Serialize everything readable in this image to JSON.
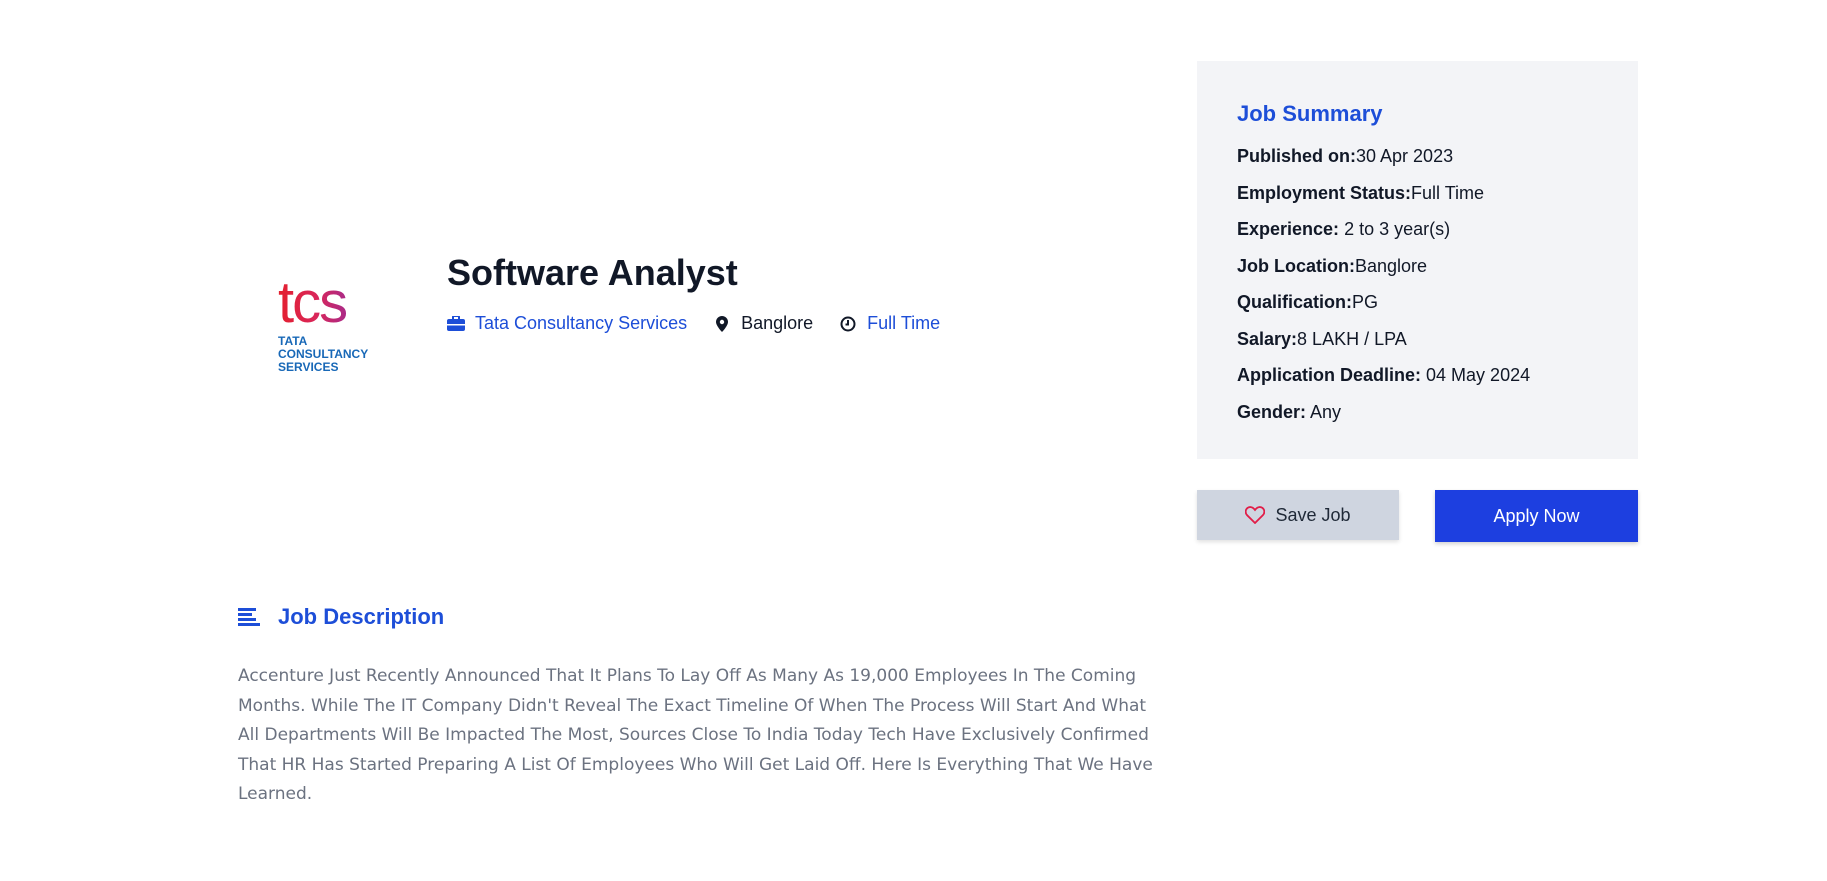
{
  "job": {
    "logo_text": "tcs",
    "logo_sub": [
      "TATA",
      "CONSULTANCY",
      "SERVICES"
    ],
    "title": "Software Analyst",
    "company": "Tata Consultancy Services",
    "location": "Banglore",
    "type": "Full Time"
  },
  "summary": {
    "heading": "Job Summary",
    "rows": [
      {
        "label": "Published on:",
        "value": "30 Apr 2023"
      },
      {
        "label": "Employment Status:",
        "value": "Full Time"
      },
      {
        "label": "Experience:",
        "value": " 2 to 3 year(s)"
      },
      {
        "label": "Job Location:",
        "value": "Banglore"
      },
      {
        "label": "Qualification:",
        "value": "PG"
      },
      {
        "label": "Salary:",
        "value": "8 LAKH / LPA"
      },
      {
        "label": "Application Deadline:",
        "value": " 04 May 2024"
      },
      {
        "label": "Gender:",
        "value": " Any"
      }
    ]
  },
  "actions": {
    "save_label": "Save Job",
    "apply_label": "Apply Now"
  },
  "description": {
    "heading": "Job Description",
    "body": "Accenture Just Recently Announced That It Plans To Lay Off As Many As 19,000 Employees In The Coming Months. While The IT Company Didn't Reveal The Exact Timeline Of When The Process Will Start And What All Departments Will Be Impacted The Most, Sources Close To India Today Tech Have Exclusively Confirmed That HR Has Started Preparing A List Of Employees Who Will Get Laid Off. Here Is Everything That We Have Learned."
  },
  "icons": {
    "company": "briefcase-icon",
    "location": "map-pin-icon",
    "type": "clock-icon",
    "save": "heart-icon",
    "description": "align-left-icon"
  },
  "colors": {
    "accent": "#1d4ed8",
    "apply_bg": "#1d3fe0",
    "save_bg": "#cfd5e0",
    "card_bg": "#f3f4f7",
    "heart": "#e11d48"
  }
}
